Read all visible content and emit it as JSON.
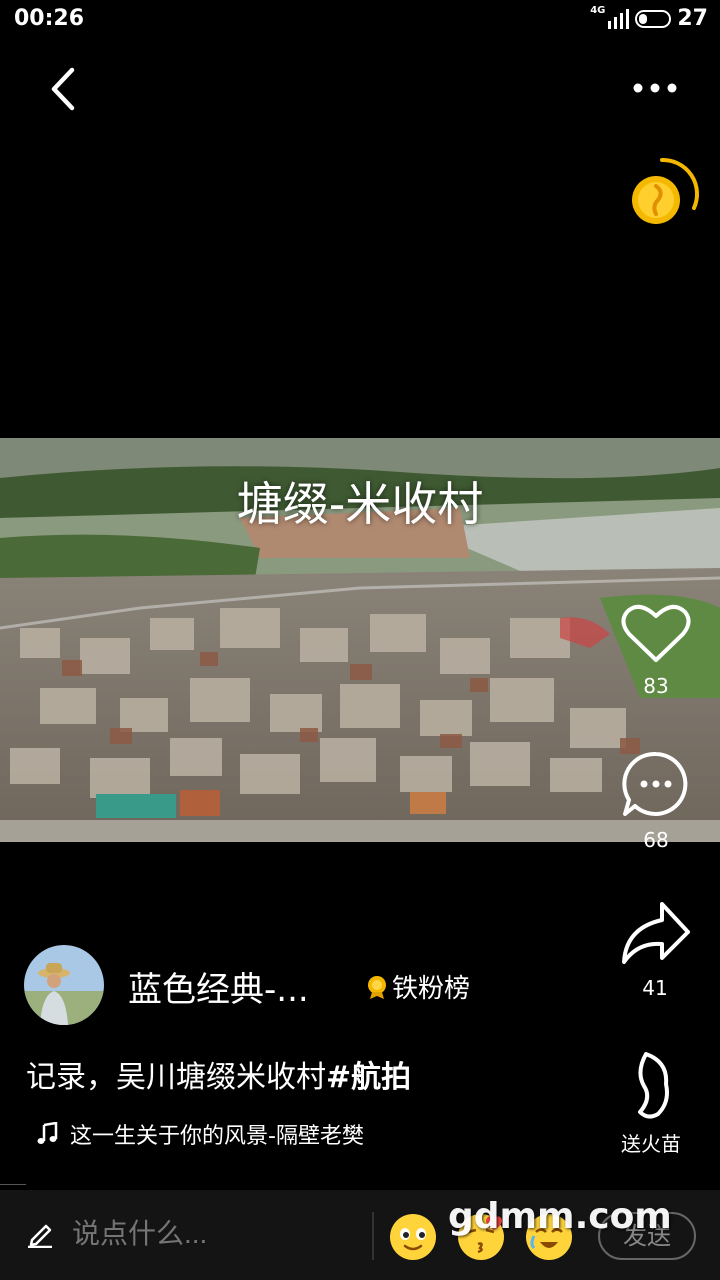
{
  "status_bar": {
    "time": "00:26",
    "network": "4G",
    "battery": "27"
  },
  "icons": {
    "back": "back-arrow-icon",
    "more": "more-dots-icon",
    "coin": "coin-reward-icon",
    "like": "heart-icon",
    "comment": "comment-bubble-icon",
    "share": "share-arrow-icon",
    "fire": "fire-sprout-icon",
    "music": "music-note-icon",
    "pen": "pen-icon",
    "rank": "rank-medal-icon"
  },
  "video": {
    "caption": "塘缀-米收村"
  },
  "actions": {
    "likes": "83",
    "comments": "68",
    "shares": "41",
    "fire_label": "送火苗"
  },
  "author": {
    "name": "蓝色经典-...",
    "rank_label": "铁粉榜"
  },
  "description": {
    "text": "记录，吴川塘缀米收村",
    "hashtag": "#航拍"
  },
  "music": {
    "track": "这一生关于你的风景-隔壁老樊"
  },
  "comment_bar": {
    "placeholder": "说点什么...",
    "send_label": "发送"
  },
  "watermark": "gdmm.com",
  "colors": {
    "background": "#000000",
    "coin": "#f5b800",
    "bottom_bar": "#141414"
  }
}
